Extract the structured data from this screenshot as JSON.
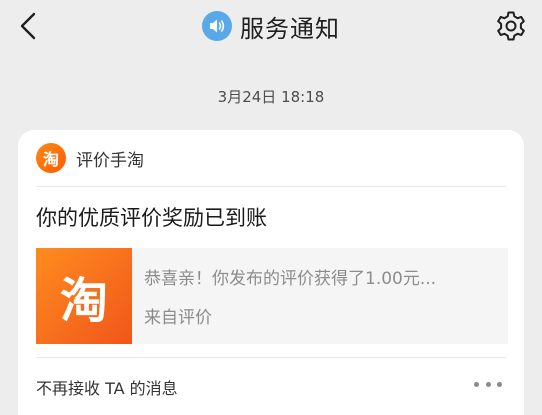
{
  "header": {
    "title": "服务通知",
    "back_icon": "chevron-left-icon",
    "speaker_icon": "speaker-icon",
    "settings_icon": "gear-icon"
  },
  "timestamp": "3月24日 18:18",
  "card": {
    "brand_name": "评价手淘",
    "brand_logo_char": "淘",
    "message_title": "你的优质评价奖励已到账",
    "preview": {
      "thumb_char": "淘",
      "line1": "恭喜亲！你发布的评价获得了1.00元...",
      "line2": "来自评价"
    },
    "footer_action": "不再接收 TA 的消息",
    "more_icon": "more-dots-icon"
  },
  "colors": {
    "background": "#ededed",
    "card": "#ffffff",
    "brand_orange": "#ff6a00",
    "speaker_blue": "#59a8ea"
  }
}
